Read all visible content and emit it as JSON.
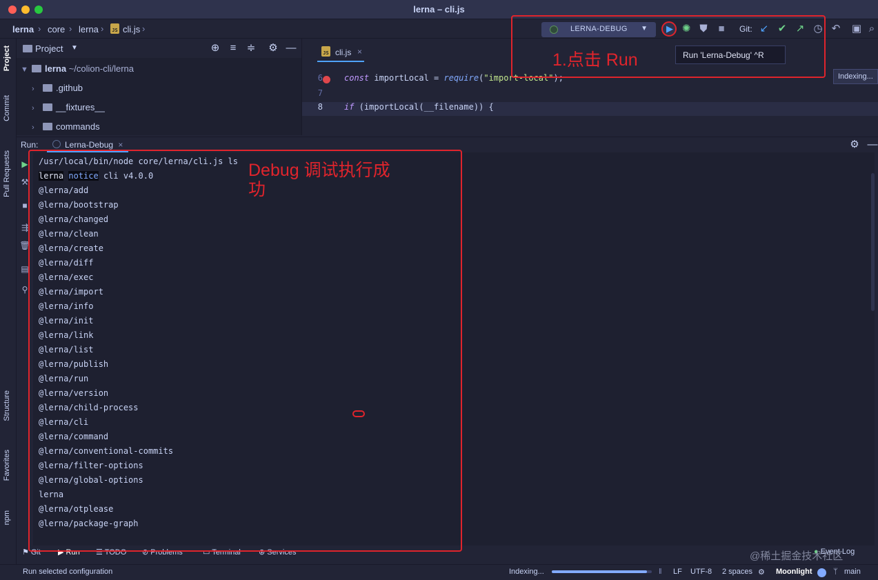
{
  "window": {
    "title": "lerna – cli.js"
  },
  "breadcrumb": {
    "items": [
      "lerna",
      "core",
      "lerna",
      "cli.js"
    ]
  },
  "toolbar": {
    "run_config": "LERNA-DEBUG",
    "git_label": "Git:",
    "tooltip": "Run 'Lerna-Debug'  ^R",
    "indexing_popup": "Indexing..."
  },
  "left_strip": {
    "tabs": [
      "Project",
      "Commit",
      "Pull Requests",
      "Structure",
      "Favorites",
      "npm"
    ]
  },
  "project_panel": {
    "title": "Project",
    "root_name": "lerna",
    "root_path": "~/colion-cli/lerna",
    "items": [
      ".github",
      "__fixtures__",
      "commands"
    ]
  },
  "editor": {
    "tab": "cli.js",
    "lines": [
      {
        "num": "6",
        "kw": "const",
        "before": " importLocal = ",
        "fn": "require",
        "paren_open": "(",
        "str": "\"import-local\"",
        "after": ");"
      },
      {
        "num": "7"
      },
      {
        "num": "8",
        "kw": "if",
        "rest": " (importLocal(__filename)) {"
      }
    ]
  },
  "run_panel": {
    "label": "Run:",
    "tab": "Lerna-Debug",
    "command": "/usr/local/bin/node core/lerna/cli.js ls",
    "notice": {
      "a": "lerna",
      "b": "notice",
      "c": " cli v4.0.0"
    },
    "packages": [
      "@lerna/add",
      "@lerna/bootstrap",
      "@lerna/changed",
      "@lerna/clean",
      "@lerna/create",
      "@lerna/diff",
      "@lerna/exec",
      "@lerna/import",
      "@lerna/info",
      "@lerna/init",
      "@lerna/link",
      "@lerna/list",
      "@lerna/publish",
      "@lerna/run",
      "@lerna/version",
      "@lerna/child-process",
      "@lerna/cli",
      "@lerna/command",
      "@lerna/conventional-commits",
      "@lerna/filter-options",
      "@lerna/global-options",
      "lerna",
      "@lerna/otplease",
      "@lerna/package-graph"
    ]
  },
  "bottom_tools": {
    "items": [
      "Git",
      "Run",
      "TODO",
      "Problems",
      "Terminal",
      "Services"
    ],
    "event_log": "Event Log"
  },
  "status_bar": {
    "message": "Run selected configuration",
    "indexing": "Indexing...",
    "indexing_progress": 0.95,
    "line_sep": "LF",
    "encoding": "UTF-8",
    "indent": "2 spaces",
    "theme": "Moonlight",
    "branch": "main"
  },
  "annotations": {
    "step1": "1.点击 Run",
    "debug_line1": "Debug 调试执行成",
    "debug_line2": "功",
    "color": "#e0242c"
  },
  "watermark": "@稀土掘金技术社区"
}
